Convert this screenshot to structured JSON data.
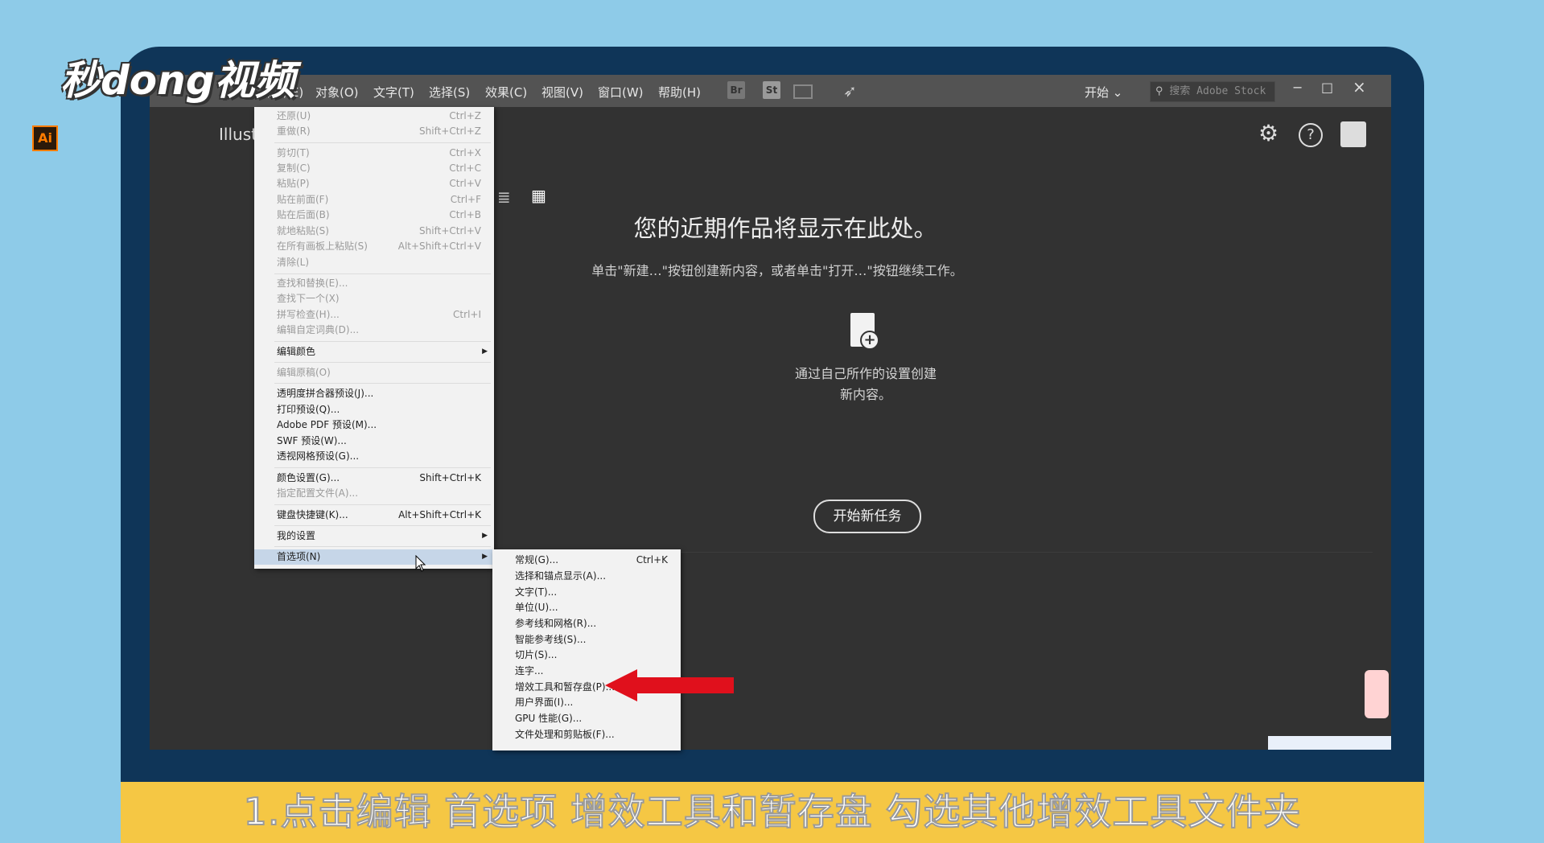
{
  "brand": {
    "logo_text": "秒dong视频"
  },
  "menubar": {
    "items": [
      "编辑(E)",
      "对象(O)",
      "文字(T)",
      "选择(S)",
      "效果(C)",
      "视图(V)",
      "窗口(W)",
      "帮助(H)"
    ],
    "toolbar": [
      "Br",
      "St"
    ],
    "workspace": "开始",
    "search_placeholder": "搜索 Adobe Stock",
    "min": "−",
    "max": "□",
    "close": "×"
  },
  "app": {
    "logo": "Ai",
    "title": "Illust"
  },
  "home": {
    "heading": "您的近期作品将显示在此处。",
    "subtext": "单击\"新建…\"按钮创建新内容，或者单击\"打开…\"按钮继续工作。",
    "create_text_1": "通过自己所作的设置创建",
    "create_text_2": "新内容。",
    "new_button": "开始新任务"
  },
  "edit_menu": [
    {
      "label": "还原(U)",
      "shortcut": "Ctrl+Z",
      "disabled": true
    },
    {
      "label": "重做(R)",
      "shortcut": "Shift+Ctrl+Z",
      "disabled": true
    },
    {
      "label": "剪切(T)",
      "shortcut": "Ctrl+X",
      "disabled": true
    },
    {
      "label": "复制(C)",
      "shortcut": "Ctrl+C",
      "disabled": true
    },
    {
      "label": "粘贴(P)",
      "shortcut": "Ctrl+V",
      "disabled": true
    },
    {
      "label": "贴在前面(F)",
      "shortcut": "Ctrl+F",
      "disabled": true
    },
    {
      "label": "贴在后面(B)",
      "shortcut": "Ctrl+B",
      "disabled": true
    },
    {
      "label": "就地粘贴(S)",
      "shortcut": "Shift+Ctrl+V",
      "disabled": true
    },
    {
      "label": "在所有画板上粘贴(S)",
      "shortcut": "Alt+Shift+Ctrl+V",
      "disabled": true
    },
    {
      "label": "清除(L)",
      "shortcut": "",
      "disabled": true
    },
    {
      "label": "查找和替换(E)...",
      "shortcut": "",
      "disabled": true
    },
    {
      "label": "查找下一个(X)",
      "shortcut": "",
      "disabled": true
    },
    {
      "label": "拼写检查(H)...",
      "shortcut": "Ctrl+I",
      "disabled": true
    },
    {
      "label": "编辑自定词典(D)...",
      "shortcut": "",
      "disabled": true
    },
    {
      "label": "编辑颜色",
      "shortcut": "",
      "disabled": false
    },
    {
      "label": "编辑原稿(O)",
      "shortcut": "",
      "disabled": true
    },
    {
      "label": "透明度拼合器预设(J)...",
      "shortcut": "",
      "disabled": false
    },
    {
      "label": "打印预设(Q)...",
      "shortcut": "",
      "disabled": false
    },
    {
      "label": "Adobe PDF 预设(M)...",
      "shortcut": "",
      "disabled": false
    },
    {
      "label": "SWF 预设(W)...",
      "shortcut": "",
      "disabled": false
    },
    {
      "label": "透视网格预设(G)...",
      "shortcut": "",
      "disabled": false
    },
    {
      "label": "颜色设置(G)...",
      "shortcut": "Shift+Ctrl+K",
      "disabled": false
    },
    {
      "label": "指定配置文件(A)...",
      "shortcut": "",
      "disabled": true
    },
    {
      "label": "键盘快捷键(K)...",
      "shortcut": "Alt+Shift+Ctrl+K",
      "disabled": false
    },
    {
      "label": "我的设置",
      "shortcut": "",
      "disabled": false
    },
    {
      "label": "首选项(N)",
      "shortcut": "",
      "disabled": false
    }
  ],
  "pref_menu": [
    {
      "label": "常规(G)...",
      "shortcut": "Ctrl+K"
    },
    {
      "label": "选择和锚点显示(A)...",
      "shortcut": ""
    },
    {
      "label": "文字(T)...",
      "shortcut": ""
    },
    {
      "label": "单位(U)...",
      "shortcut": ""
    },
    {
      "label": "参考线和网格(R)...",
      "shortcut": ""
    },
    {
      "label": "智能参考线(S)...",
      "shortcut": ""
    },
    {
      "label": "切片(S)...",
      "shortcut": ""
    },
    {
      "label": "连字...",
      "shortcut": ""
    },
    {
      "label": "增效工具和暂存盘(P)...",
      "shortcut": ""
    },
    {
      "label": "用户界面(I)...",
      "shortcut": ""
    },
    {
      "label": "GPU 性能(G)...",
      "shortcut": ""
    },
    {
      "label": "文件处理和剪贴板(F)...",
      "shortcut": ""
    }
  ],
  "subtitle": "1.点击编辑 首选项 增效工具和暂存盘 勾选其他增效工具文件夹",
  "colors": {
    "arrow": "#e0101c",
    "ai_orange": "#ff7c00",
    "caption_bar": "#f5c744"
  }
}
